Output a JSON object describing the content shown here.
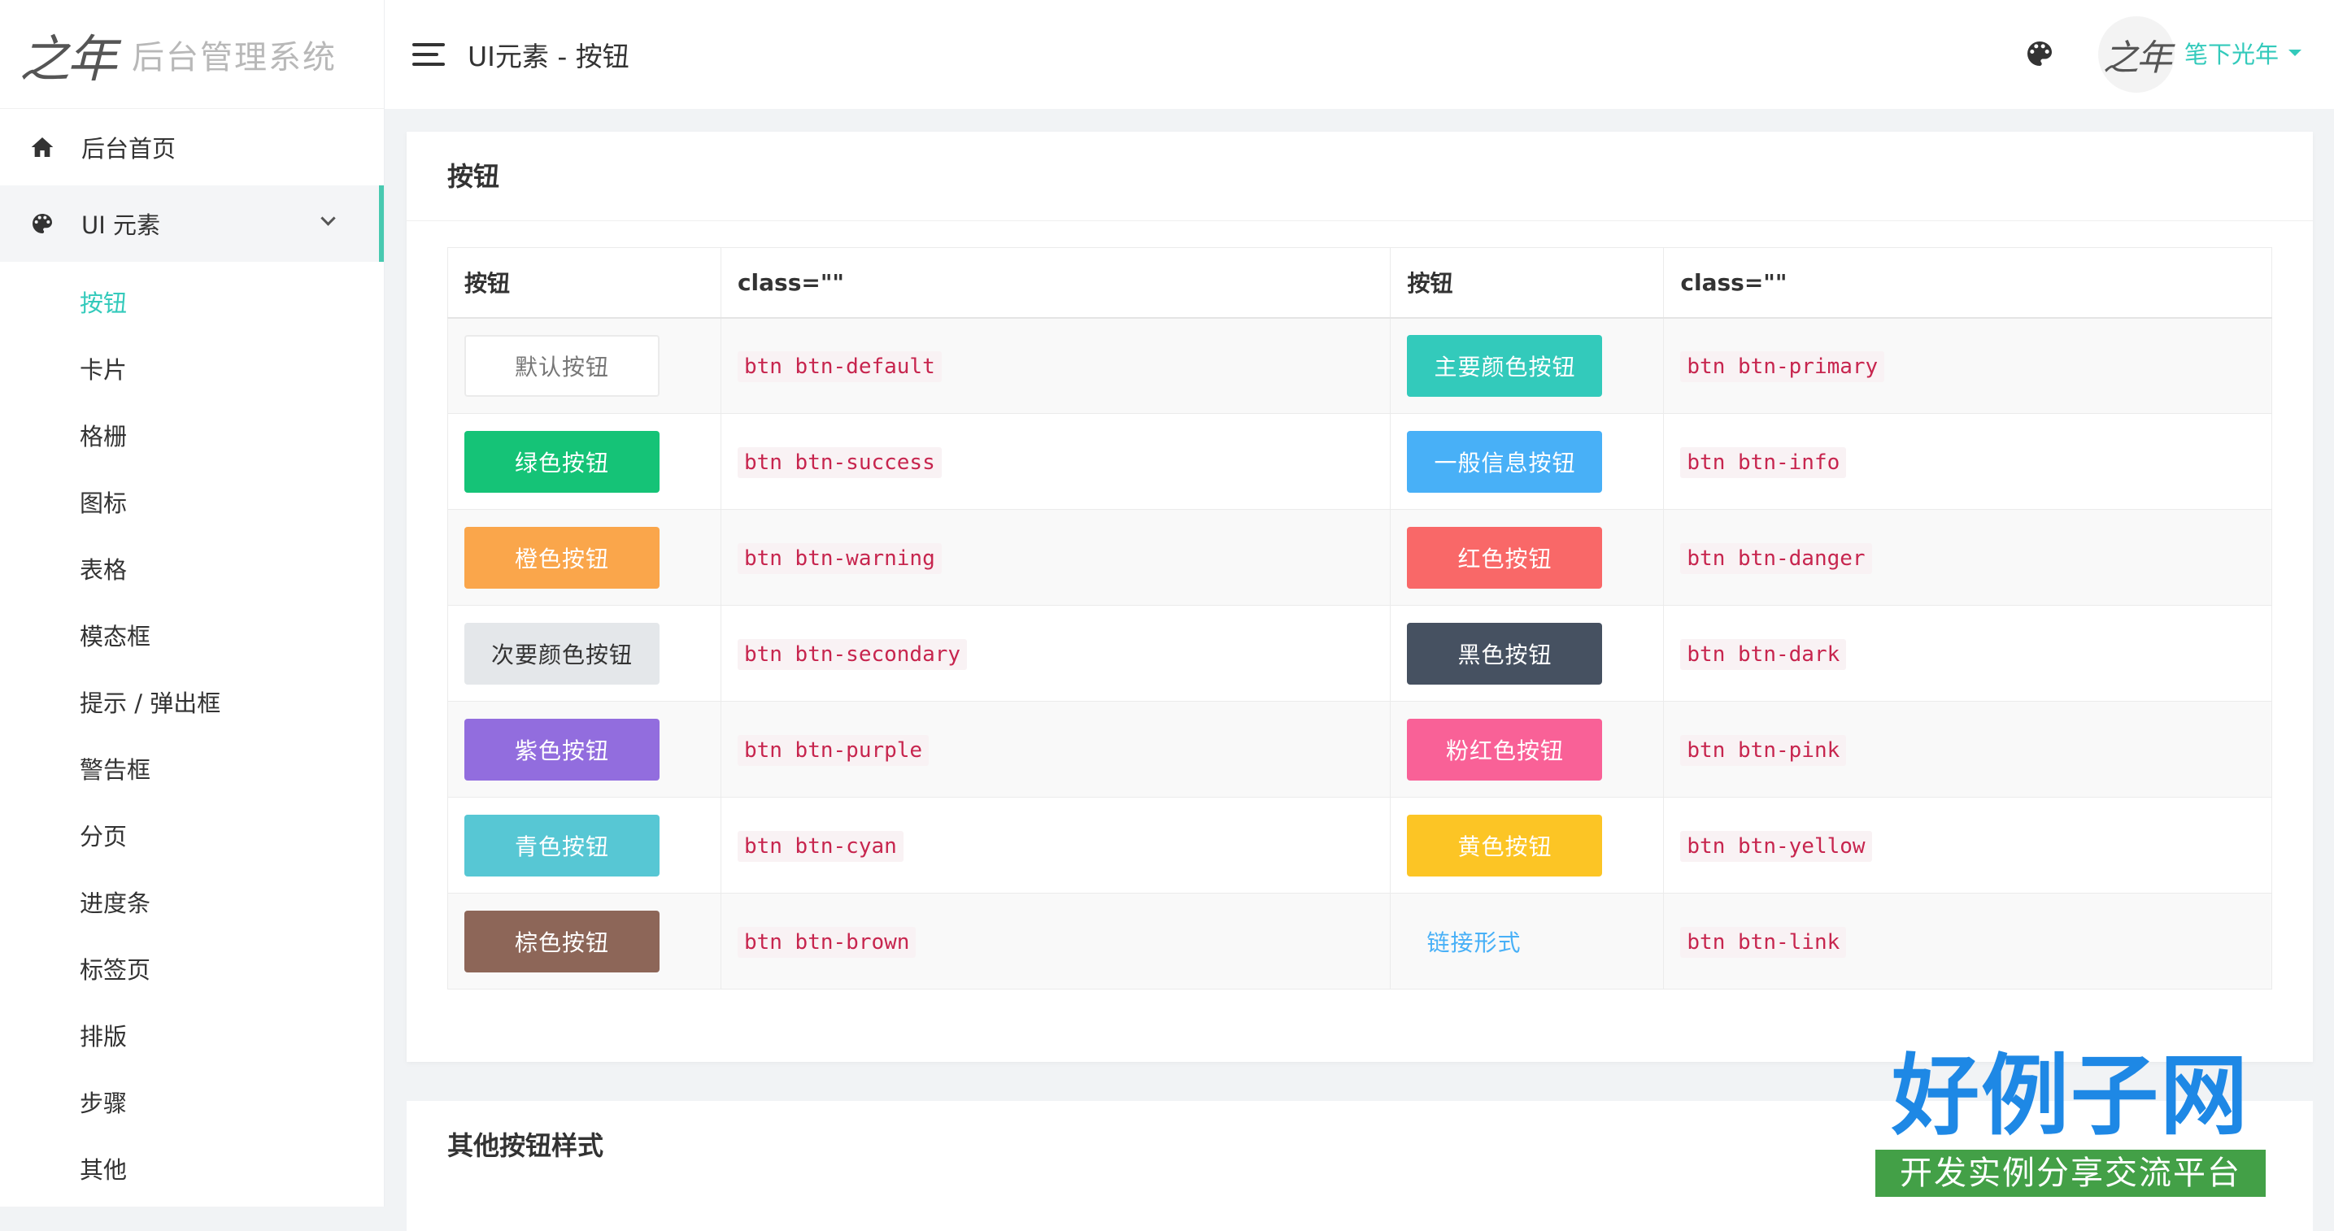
{
  "brand": {
    "logo_text": "之年",
    "name": "后台管理系统"
  },
  "sidebar": {
    "items": [
      {
        "label": "后台首页",
        "icon": "home-icon"
      },
      {
        "label": "UI 元素",
        "icon": "palette-icon"
      }
    ],
    "sub_items": [
      "按钮",
      "卡片",
      "格栅",
      "图标",
      "表格",
      "模态框",
      "提示 / 弹出框",
      "警告框",
      "分页",
      "进度条",
      "标签页",
      "排版",
      "步骤",
      "其他"
    ]
  },
  "header": {
    "title": "UI元素 - 按钮",
    "user_name": "笔下光年",
    "avatar_text": "之年"
  },
  "main": {
    "card_title": "按钮",
    "table_headers": [
      "按钮",
      "class=\"\"",
      "按钮",
      "class=\"\""
    ],
    "rows": [
      {
        "a_label": "默认按钮",
        "a_class": "btn btn-default",
        "b_label": "主要颜色按钮",
        "b_class": "btn btn-primary"
      },
      {
        "a_label": "绿色按钮",
        "a_class": "btn btn-success",
        "b_label": "一般信息按钮",
        "b_class": "btn btn-info"
      },
      {
        "a_label": "橙色按钮",
        "a_class": "btn btn-warning",
        "b_label": "红色按钮",
        "b_class": "btn btn-danger"
      },
      {
        "a_label": "次要颜色按钮",
        "a_class": "btn btn-secondary",
        "b_label": "黑色按钮",
        "b_class": "btn btn-dark"
      },
      {
        "a_label": "紫色按钮",
        "a_class": "btn btn-purple",
        "b_label": "粉红色按钮",
        "b_class": "btn btn-pink"
      },
      {
        "a_label": "青色按钮",
        "a_class": "btn btn-cyan",
        "b_label": "黄色按钮",
        "b_class": "btn btn-yellow"
      },
      {
        "a_label": "棕色按钮",
        "a_class": "btn btn-brown",
        "b_label": "链接形式",
        "b_class": "btn btn-link"
      }
    ],
    "card2_title": "其他按钮样式"
  },
  "watermark": {
    "main": "好例子网",
    "sub": "开发实例分享交流平台"
  },
  "colors": {
    "accent": "#33cabb",
    "primary": "#33cabb",
    "success": "#15c377",
    "info": "#48b0f7",
    "warning": "#faa64b",
    "danger": "#f96868",
    "dark": "#465161",
    "purple": "#926dde",
    "pink": "#f96197",
    "cyan": "#57c7d4",
    "yellow": "#fcc525",
    "brown": "#8d6658"
  }
}
